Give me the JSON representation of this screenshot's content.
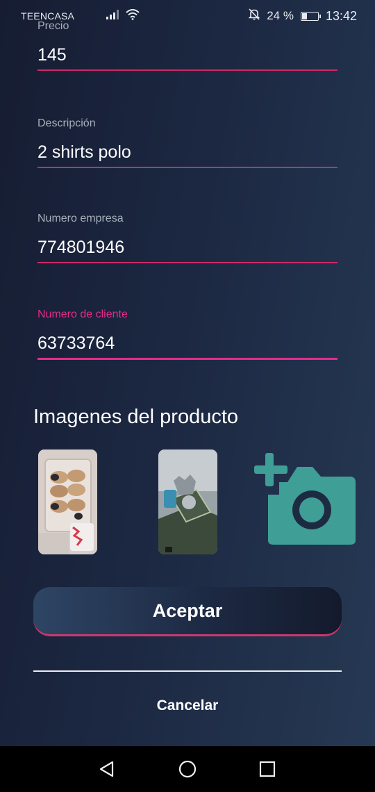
{
  "status_bar": {
    "carrier": "TEENCASA",
    "battery_percent": "24 %",
    "time": "13:42",
    "icons": [
      "signal-icon",
      "wifi-icon",
      "bell-off-icon",
      "battery-icon"
    ]
  },
  "form": {
    "fields": [
      {
        "label": "Precio",
        "value": "145"
      },
      {
        "label": "Descripción",
        "value": "2 shirts polo"
      },
      {
        "label": "Numero empresa",
        "value": "774801946"
      },
      {
        "label": "Numero de cliente",
        "value": "63733764",
        "focused": true
      }
    ]
  },
  "images_section": {
    "title": "Imagenes del producto",
    "add_icon": "add-photo-icon"
  },
  "actions": {
    "accept_label": "Aceptar",
    "cancel_label": "Cancelar"
  },
  "colors": {
    "accent": "#e52c8c",
    "underline": "#cc2a68",
    "camera_icon": "#3f9e96",
    "background_start": "#161d32",
    "background_end": "#263954"
  }
}
